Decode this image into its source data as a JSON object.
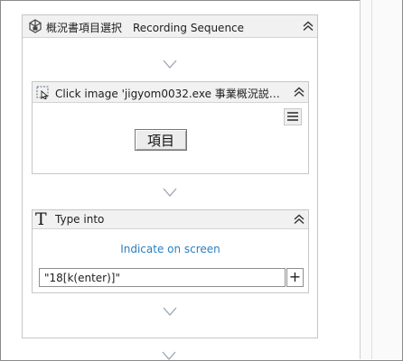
{
  "sequence": {
    "title": "概況書項目選択　Recording Sequence",
    "icon": "sequence-icon"
  },
  "activities": [
    {
      "title": "Click image 'jigyom0032.exe 事業概況説明書シ...",
      "icon": "click-image-icon",
      "image_label": "項目"
    },
    {
      "title": "Type into",
      "icon_glyph": "T",
      "indicate_link": "Indicate on screen",
      "text_value": "\"18[k(enter)]\"",
      "add_button": "+"
    }
  ],
  "colors": {
    "link": "#2b7fc1",
    "header_bg": "#f1f1f1",
    "border": "#c6c6c6"
  }
}
